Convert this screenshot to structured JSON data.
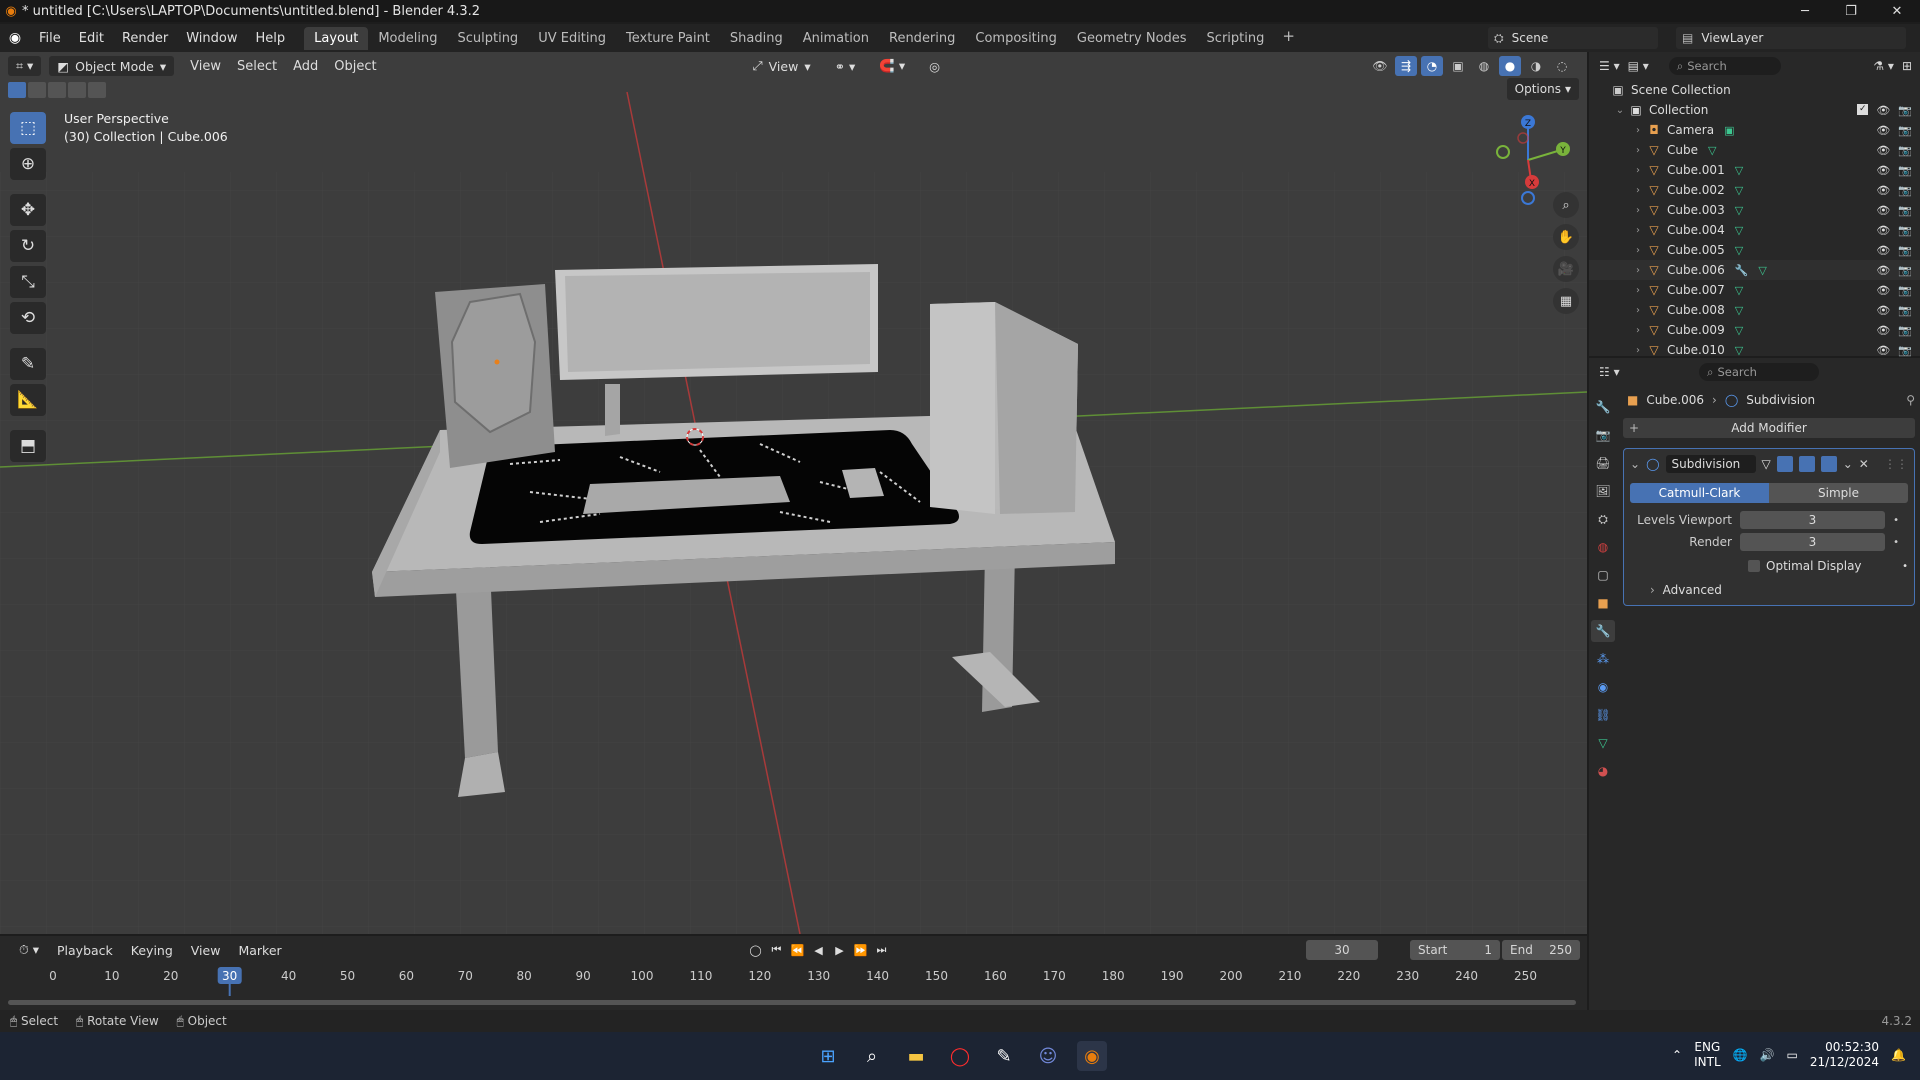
{
  "window": {
    "title": "* untitled [C:\\Users\\LAPTOP\\Documents\\untitled.blend] - Blender 4.3.2",
    "controls": [
      "minimize-icon",
      "maximize-icon",
      "close-icon"
    ]
  },
  "menu": [
    "File",
    "Edit",
    "Render",
    "Window",
    "Help"
  ],
  "workspaces": {
    "tabs": [
      "Layout",
      "Modeling",
      "Sculpting",
      "UV Editing",
      "Texture Paint",
      "Shading",
      "Animation",
      "Rendering",
      "Compositing",
      "Geometry Nodes",
      "Scripting"
    ],
    "active": "Layout"
  },
  "scene": {
    "name": "Scene",
    "view_layer": "ViewLayer"
  },
  "viewport": {
    "mode": "Object Mode",
    "menus": [
      "View",
      "Select",
      "Add",
      "Object"
    ],
    "orientation": "View",
    "options_label": "Options",
    "perspective_text": "User Perspective",
    "context_text": "(30) Collection | Cube.006"
  },
  "outliner": {
    "search_placeholder": "Search",
    "scene_collection": "Scene Collection",
    "collection": "Collection",
    "objects": [
      "Camera",
      "Cube",
      "Cube.001",
      "Cube.002",
      "Cube.003",
      "Cube.004",
      "Cube.005",
      "Cube.006",
      "Cube.007",
      "Cube.008",
      "Cube.009",
      "Cube.010"
    ]
  },
  "properties": {
    "search_placeholder": "Search",
    "object_name": "Cube.006",
    "modifier_crumb": "Subdivision",
    "add_modifier_label": "Add Modifier",
    "modifier": {
      "name": "Subdivision",
      "mode_a": "Catmull-Clark",
      "mode_b": "Simple",
      "levels_viewport_label": "Levels Viewport",
      "levels_viewport_value": "3",
      "render_label": "Render",
      "render_value": "3",
      "optimal_display_label": "Optimal Display",
      "advanced_label": "Advanced"
    }
  },
  "timeline": {
    "menus": [
      "Playback",
      "Keying",
      "View",
      "Marker"
    ],
    "current_frame": "30",
    "start_label": "Start",
    "start_value": "1",
    "end_label": "End",
    "end_value": "250",
    "ruler": [
      "0",
      "10",
      "20",
      "30",
      "40",
      "50",
      "60",
      "70",
      "80",
      "90",
      "100",
      "110",
      "120",
      "130",
      "140",
      "150",
      "160",
      "170",
      "180",
      "190",
      "200",
      "210",
      "220",
      "230",
      "240",
      "250"
    ]
  },
  "statusbar": {
    "hints": [
      "Select",
      "Rotate View",
      "Object"
    ],
    "version": "4.3.2"
  },
  "taskbar": {
    "lang_line1": "ENG",
    "lang_line2": "INTL",
    "time": "00:52:30",
    "date": "21/12/2024"
  },
  "colors": {
    "accent": "#4772b3",
    "viewport_bg": "#3d3d3d",
    "x_axis": "#d63b3b",
    "y_axis": "#79b33b",
    "z_axis": "#3b78d6"
  }
}
